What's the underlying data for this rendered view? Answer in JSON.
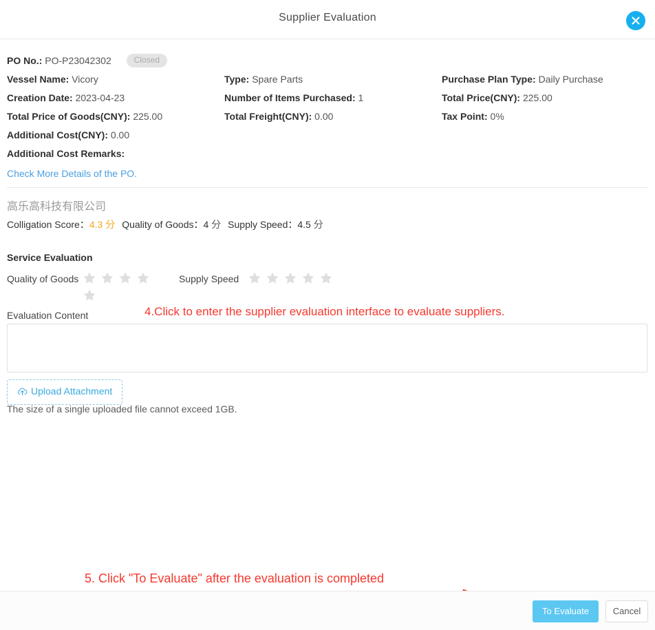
{
  "header": {
    "title": "Supplier Evaluation",
    "close_icon": "close-icon"
  },
  "po": {
    "rows": [
      [
        {
          "label": "PO No.:",
          "value": "PO-P23042302",
          "badge": "Closed"
        },
        null,
        null
      ],
      [
        {
          "label": "Vessel Name:",
          "value": "Vicory"
        },
        {
          "label": "Type:",
          "value": "Spare Parts"
        },
        {
          "label": "Purchase Plan Type:",
          "value": "Daily Purchase"
        }
      ],
      [
        {
          "label": "Creation Date:",
          "value": "2023-04-23"
        },
        {
          "label": "Number of Items Purchased:",
          "value": "1"
        },
        {
          "label": "Total Price(CNY):",
          "value": "225.00"
        }
      ],
      [
        {
          "label": "Total Price of Goods(CNY):",
          "value": "225.00"
        },
        {
          "label": "Total Freight(CNY):",
          "value": "0.00"
        },
        {
          "label": "Tax Point:",
          "value": "0%"
        }
      ],
      [
        {
          "label": "Additional Cost(CNY):",
          "value": "0.00"
        },
        null,
        null
      ],
      [
        {
          "label": "Additional Cost Remarks:",
          "value": ""
        },
        null,
        null
      ]
    ],
    "fields": {
      "po_no_label": "PO No.:",
      "po_no_value": "PO-P23042302",
      "status_badge": "Closed",
      "vessel_label": "Vessel Name:",
      "vessel_value": "Vicory",
      "type_label": "Type:",
      "type_value": "Spare Parts",
      "plan_type_label": "Purchase Plan Type:",
      "plan_type_value": "Daily Purchase",
      "creation_label": "Creation Date:",
      "creation_value": "2023-04-23",
      "items_label": "Number of Items Purchased:",
      "items_value": "1",
      "total_price_label": "Total Price(CNY):",
      "total_price_value": "225.00",
      "goods_price_label": "Total Price of Goods(CNY):",
      "goods_price_value": "225.00",
      "freight_label": "Total Freight(CNY):",
      "freight_value": "0.00",
      "tax_label": "Tax Point:",
      "tax_value": "0%",
      "addcost_label": "Additional Cost(CNY):",
      "addcost_value": "0.00",
      "addremarks_label": "Additional Cost Remarks:",
      "addremarks_value": ""
    },
    "more_link": "Check More Details of the PO."
  },
  "supplier": {
    "name": "高乐高科技有限公司",
    "scores": {
      "colligation_label": "Colligation Score：",
      "colligation_value": "4.3",
      "quality_label": "Quality of Goods：",
      "quality_value": "4",
      "speed_label": "Supply Speed：",
      "speed_value": "4.5",
      "unit": "分",
      "highlight_color": "#f5a623"
    }
  },
  "service_evaluation": {
    "section_title": "Service Evaluation",
    "quality_label": "Quality of Goods",
    "quality_stars_total": 5,
    "quality_stars_filled": 0,
    "speed_label": "Supply Speed",
    "speed_stars_total": 5,
    "speed_stars_filled": 0,
    "content_label": "Evaluation Content",
    "content_value": "",
    "content_placeholder": "",
    "upload_button": "Upload Attachment",
    "upload_icon": "cloud-upload-icon",
    "upload_hint": "The size of a single uploaded file cannot exceed 1GB."
  },
  "annotations": {
    "step4": "4.Click to enter the supplier evaluation interface to evaluate suppliers.",
    "step5": "5. Click \"To Evaluate\" after the evaluation is completed",
    "color": "#f4392f"
  },
  "footer": {
    "primary_button": "To Evaluate",
    "cancel_button": "Cancel",
    "primary_color": "#5cc8f2"
  }
}
